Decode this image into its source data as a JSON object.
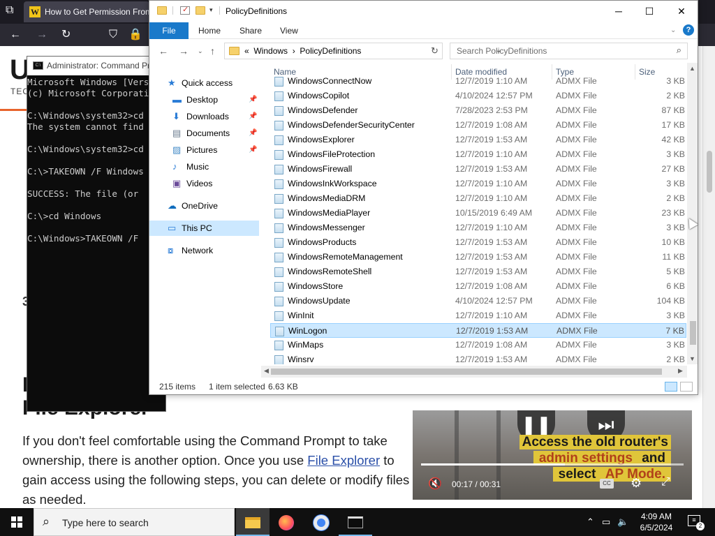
{
  "browser": {
    "tab_title": "How to Get Permission From",
    "favicon_letter": "W"
  },
  "article": {
    "logo_fragment": "U",
    "logo_sub": "TEC",
    "step_number": "3",
    "heading_fragment": "H",
    "heading": "File Explorer",
    "body_before": "If you don't feel comfortable using the Command Prompt to take ownership, there is another option. Once you use ",
    "link_text": "File Explorer",
    "body_after": " to gain access using the following steps, you can delete or modify files as needed."
  },
  "video": {
    "caption_line1": "Access the old router's",
    "caption_line2_accent": "admin settings",
    "caption_line2_rest": " and",
    "caption_line3_pre": "select ",
    "caption_line3_accent": "AP Mode.",
    "current_time": "00:17",
    "separator": "/",
    "duration": "00:31",
    "progress_fraction": 0.548,
    "cc_label": "CC"
  },
  "cmd": {
    "title": "Administrator: Command Prompt",
    "lines": [
      "Microsoft Windows [Version",
      "(c) Microsoft Corporation",
      "",
      "C:\\Windows\\system32>cd",
      "The system cannot find",
      "",
      "C:\\Windows\\system32>cd",
      "",
      "C:\\>TAKEOWN /F Windows",
      "",
      "SUCCESS: The file (or",
      "",
      "C:\\>cd Windows",
      "",
      "C:\\Windows>TAKEOWN /F"
    ]
  },
  "explorer": {
    "title": "PolicyDefinitions",
    "ribbon_tabs": [
      "File",
      "Home",
      "Share",
      "View"
    ],
    "help_label": "?",
    "address": {
      "overflow": "«",
      "crumb1": "Windows",
      "sep": "›",
      "crumb2": "PolicyDefinitions"
    },
    "search_placeholder": "Search PolicyDefinitions",
    "nav": [
      {
        "label": "Quick access",
        "icon": "star-icon",
        "pinned": false
      },
      {
        "label": "Desktop",
        "icon": "desktop-icon",
        "pinned": true
      },
      {
        "label": "Downloads",
        "icon": "downloads-icon",
        "pinned": true
      },
      {
        "label": "Documents",
        "icon": "documents-icon",
        "pinned": true
      },
      {
        "label": "Pictures",
        "icon": "pictures-icon",
        "pinned": true
      },
      {
        "label": "Music",
        "icon": "music-icon",
        "pinned": false
      },
      {
        "label": "Videos",
        "icon": "videos-icon",
        "pinned": false
      },
      {
        "label": "OneDrive",
        "icon": "cloud-icon",
        "pinned": false
      },
      {
        "label": "This PC",
        "icon": "computer-icon",
        "pinned": false
      },
      {
        "label": "Network",
        "icon": "network-icon",
        "pinned": false
      }
    ],
    "columns": {
      "name": "Name",
      "date": "Date modified",
      "type": "Type",
      "size": "Size"
    },
    "files": [
      {
        "name": "WindowsConnectNow",
        "date": "12/7/2019 1:10 AM",
        "type": "ADMX File",
        "size": "3 KB"
      },
      {
        "name": "WindowsCopilot",
        "date": "4/10/2024 12:57 PM",
        "type": "ADMX File",
        "size": "2 KB"
      },
      {
        "name": "WindowsDefender",
        "date": "7/28/2023 2:53 PM",
        "type": "ADMX File",
        "size": "87 KB"
      },
      {
        "name": "WindowsDefenderSecurityCenter",
        "date": "12/7/2019 1:08 AM",
        "type": "ADMX File",
        "size": "17 KB"
      },
      {
        "name": "WindowsExplorer",
        "date": "12/7/2019 1:53 AM",
        "type": "ADMX File",
        "size": "42 KB"
      },
      {
        "name": "WindowsFileProtection",
        "date": "12/7/2019 1:10 AM",
        "type": "ADMX File",
        "size": "3 KB"
      },
      {
        "name": "WindowsFirewall",
        "date": "12/7/2019 1:53 AM",
        "type": "ADMX File",
        "size": "27 KB"
      },
      {
        "name": "WindowsInkWorkspace",
        "date": "12/7/2019 1:10 AM",
        "type": "ADMX File",
        "size": "3 KB"
      },
      {
        "name": "WindowsMediaDRM",
        "date": "12/7/2019 1:10 AM",
        "type": "ADMX File",
        "size": "2 KB"
      },
      {
        "name": "WindowsMediaPlayer",
        "date": "10/15/2019 6:49 AM",
        "type": "ADMX File",
        "size": "23 KB"
      },
      {
        "name": "WindowsMessenger",
        "date": "12/7/2019 1:10 AM",
        "type": "ADMX File",
        "size": "3 KB"
      },
      {
        "name": "WindowsProducts",
        "date": "12/7/2019 1:53 AM",
        "type": "ADMX File",
        "size": "10 KB"
      },
      {
        "name": "WindowsRemoteManagement",
        "date": "12/7/2019 1:53 AM",
        "type": "ADMX File",
        "size": "11 KB"
      },
      {
        "name": "WindowsRemoteShell",
        "date": "12/7/2019 1:53 AM",
        "type": "ADMX File",
        "size": "5 KB"
      },
      {
        "name": "WindowsStore",
        "date": "12/7/2019 1:08 AM",
        "type": "ADMX File",
        "size": "6 KB"
      },
      {
        "name": "WindowsUpdate",
        "date": "4/10/2024 12:57 PM",
        "type": "ADMX File",
        "size": "104 KB"
      },
      {
        "name": "WinInit",
        "date": "12/7/2019 1:10 AM",
        "type": "ADMX File",
        "size": "3 KB"
      },
      {
        "name": "WinLogon",
        "date": "12/7/2019 1:53 AM",
        "type": "ADMX File",
        "size": "7 KB",
        "selected": true
      },
      {
        "name": "WinMaps",
        "date": "12/7/2019 1:08 AM",
        "type": "ADMX File",
        "size": "3 KB"
      },
      {
        "name": "Winsrv",
        "date": "12/7/2019 1:53 AM",
        "type": "ADMX File",
        "size": "2 KB"
      }
    ],
    "status": {
      "item_count": "215 items",
      "selected": "1 item selected",
      "size": "6.63 KB"
    }
  },
  "taskbar": {
    "search_placeholder": "Type here to search",
    "time": "4:09 AM",
    "date": "6/5/2024",
    "notification_count": "2"
  },
  "colors": {
    "accent": "#1979ca",
    "selection": "#cce8ff",
    "caption_bg": "#e0c53a",
    "caption_accent": "#b1411a",
    "link": "#2a4fa8"
  }
}
